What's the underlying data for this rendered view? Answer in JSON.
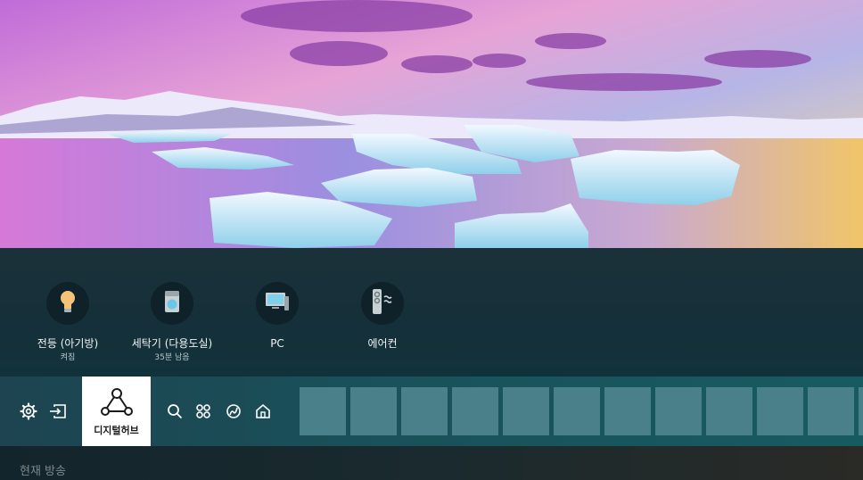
{
  "devices": [
    {
      "name": "전등 (아기방)",
      "status": "켜짐",
      "icon": "light-bulb-icon"
    },
    {
      "name": "세탁기 (다용도실)",
      "status": "35분 남음",
      "icon": "washing-machine-icon"
    },
    {
      "name": "PC",
      "status": "",
      "icon": "monitor-icon"
    },
    {
      "name": "에어컨",
      "status": "",
      "icon": "air-conditioner-icon"
    }
  ],
  "nav": {
    "settings_icon": "gear-icon",
    "input_icon": "source-input-icon",
    "hub_label": "디지털허브",
    "hub_icon": "connected-nodes-icon",
    "search_icon": "search-icon",
    "apps_icon": "apps-grid-icon",
    "ambient_icon": "ambient-icon",
    "home_icon": "home-icon"
  },
  "section": {
    "title": "현재 방송"
  },
  "colors": {
    "accent_teal": "#4a808a",
    "bulb": "#f5c27a",
    "panel_bg": "#1b3139"
  }
}
